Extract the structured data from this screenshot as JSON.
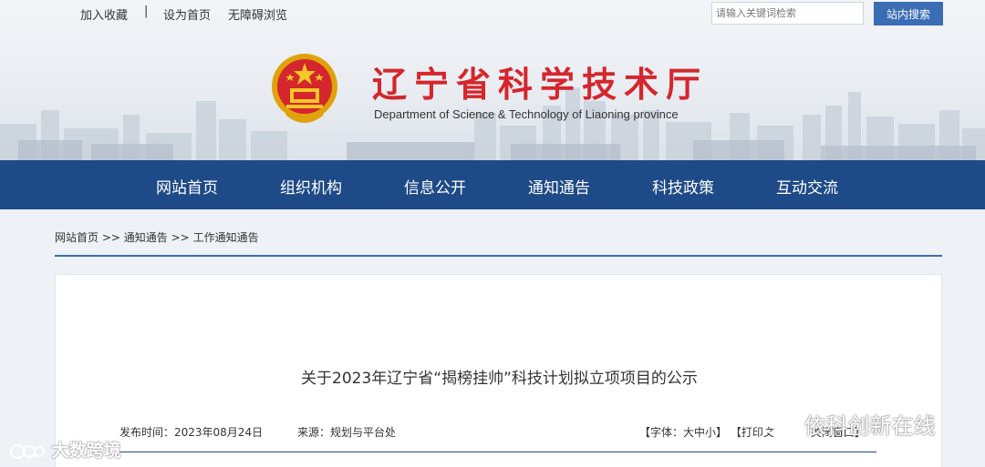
{
  "topbar": {
    "links": [
      "加入收藏",
      "设为首页",
      "无障碍浏览"
    ],
    "separator": "|",
    "search_placeholder": "请输入关键词检索",
    "search_button": "站内搜索"
  },
  "header": {
    "title": "辽宁省科学技术厅",
    "subtitle": "Department of Science & Technology of Liaoning province",
    "title_color": "#d4262c"
  },
  "nav": {
    "background": "#1e4a87",
    "items": [
      "网站首页",
      "组织机构",
      "信息公开",
      "通知通告",
      "科技政策",
      "互动交流"
    ]
  },
  "breadcrumb": {
    "items": [
      "网站首页",
      "通知通告",
      "工作通知通告"
    ],
    "separator": ">>"
  },
  "article": {
    "title": "关于2023年辽宁省“揭榜挂帅”科技计划拟立项项目的公示",
    "publish_label": "发布时间：2023年08月24日",
    "source_label": "来源：规划与平台处",
    "tools": {
      "font_label": "【字体：大中小】",
      "print_label": "【打印文",
      "close_label": "关闭窗口】"
    }
  },
  "watermarks": {
    "left": "大数跨境",
    "right": "依科创新在线"
  }
}
